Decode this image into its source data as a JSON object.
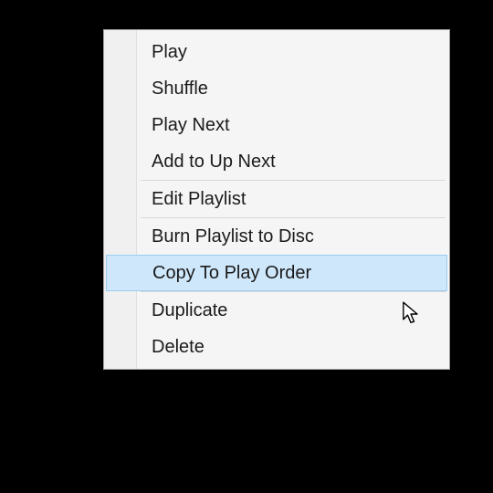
{
  "menu": {
    "groups": [
      [
        "Play",
        "Shuffle",
        "Play Next",
        "Add to Up Next"
      ],
      [
        "Edit Playlist"
      ],
      [
        "Burn Playlist to Disc",
        "Copy To Play Order"
      ],
      [
        "Duplicate",
        "Delete"
      ]
    ],
    "hovered": "Copy To Play Order"
  }
}
